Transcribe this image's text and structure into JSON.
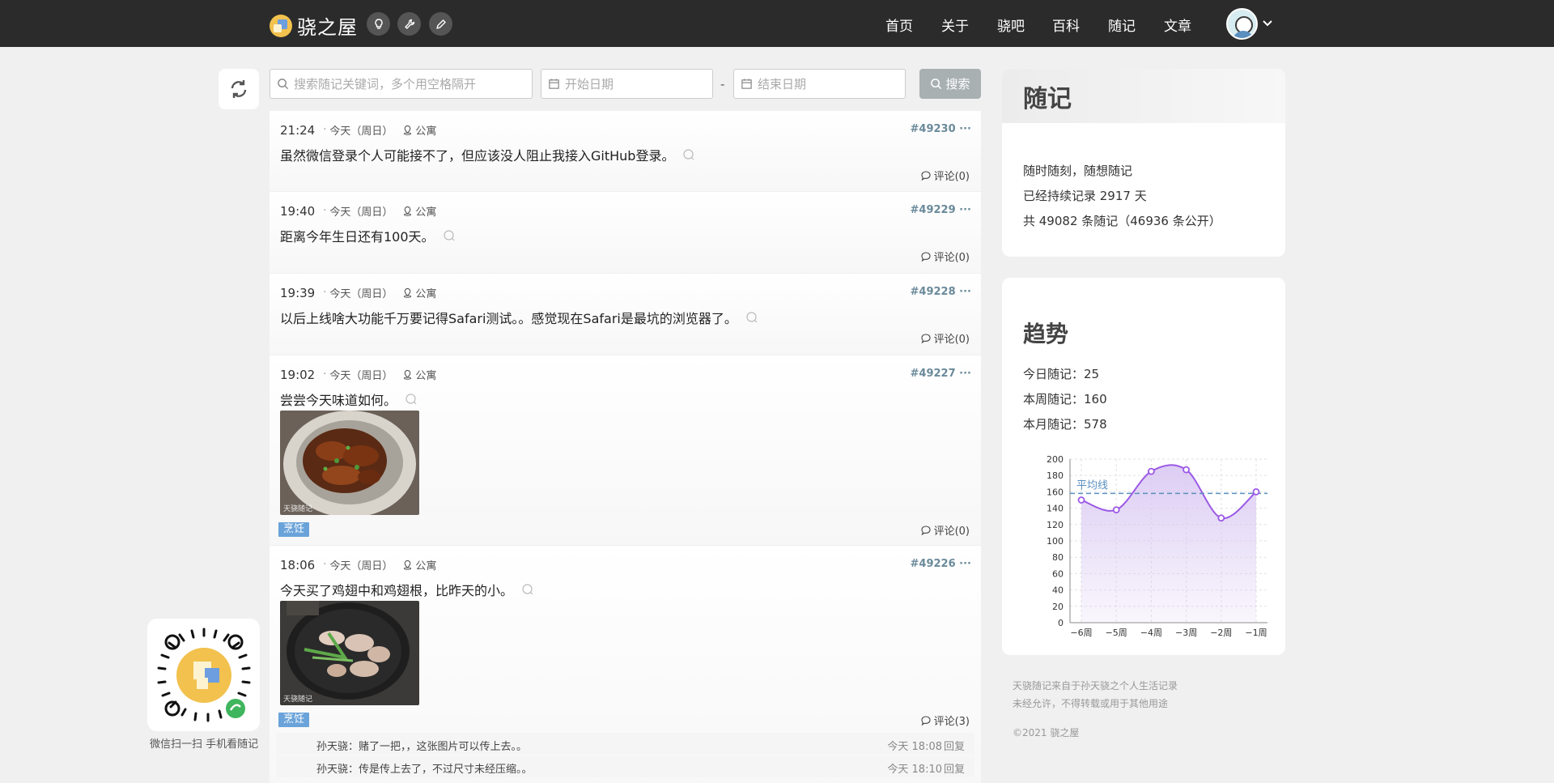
{
  "header": {
    "site_name": "骁之屋",
    "nav": [
      "首页",
      "关于",
      "骁吧",
      "百科",
      "随记",
      "文章"
    ],
    "tool_icons": [
      "lightbulb-icon",
      "wrench-icon",
      "pencil-icon"
    ]
  },
  "search": {
    "keyword_placeholder": "搜索随记关键词，多个用空格隔开",
    "start_placeholder": "开始日期",
    "end_placeholder": "结束日期",
    "separator": "-",
    "button_label": "搜索"
  },
  "entries": [
    {
      "time": "21:24",
      "day": "今天（周日）",
      "privacy": "公寓",
      "id": "#49230",
      "text": "虽然微信登录个人可能接不了，但应该没人阻止我接入GitHub登录。",
      "comments": "评论(0)"
    },
    {
      "time": "19:40",
      "day": "今天（周日）",
      "privacy": "公寓",
      "id": "#49229",
      "text": "距离今年生日还有100天。",
      "comments": "评论(0)"
    },
    {
      "time": "19:39",
      "day": "今天（周日）",
      "privacy": "公寓",
      "id": "#49228",
      "text": "以后上线啥大功能千万要记得Safari测试。。感觉现在Safari是最坑的浏览器了。",
      "comments": "评论(0)"
    },
    {
      "time": "19:02",
      "day": "今天（周日）",
      "privacy": "公寓",
      "id": "#49227",
      "text": "尝尝今天味道如何。",
      "photo_watermark": "天骁随记",
      "tag": "烹饪",
      "comments": "评论(0)"
    },
    {
      "time": "18:06",
      "day": "今天（周日）",
      "privacy": "公寓",
      "id": "#49226",
      "text": "今天买了鸡翅中和鸡翅根，比昨天的小。",
      "photo_watermark": "天骁随记",
      "tag": "烹饪",
      "comments": "评论(3)",
      "replies": [
        {
          "text": "孙天骁：赌了一把，，这张图片可以传上去。。",
          "when": "今天 18:08",
          "action": "回复"
        },
        {
          "text": "孙天骁：传是传上去了，不过尺寸未经压缩。。",
          "when": "今天 18:10",
          "action": "回复"
        }
      ]
    }
  ],
  "sidebar": {
    "about": {
      "title": "随记",
      "lines": [
        "随时随刻，随想随记",
        "已经持续记录 2917 天",
        "共 49082 条随记（46936 条公开）"
      ]
    },
    "trend": {
      "title": "趋势",
      "lines": [
        "今日随记：25",
        "本周随记：160",
        "本月随记：578"
      ]
    },
    "footer": [
      "天骁随记来自于孙天骁之个人生活记录",
      "未经允许，不得转载或用于其他用途",
      "©2021 骁之屋"
    ]
  },
  "chart_data": {
    "type": "area",
    "categories": [
      "−6周",
      "−5周",
      "−4周",
      "−3周",
      "−2周",
      "−1周"
    ],
    "values": [
      150,
      138,
      185,
      187,
      128,
      160
    ],
    "ylim": [
      0,
      200
    ],
    "yticks": [
      0,
      20,
      40,
      60,
      80,
      100,
      120,
      140,
      160,
      180,
      200
    ],
    "average_line": {
      "label": "平均线",
      "value": 158
    },
    "grid": true,
    "colors": {
      "line": "#9b59e6",
      "fill": "#d9c8f2",
      "average": "#5a8fc0"
    }
  },
  "qr": {
    "caption": "微信扫一扫 手机看随记"
  },
  "colors": {
    "topbar": "#2b2b2b",
    "tag": "#6aa3d9",
    "entry_id": "#6a8a9a"
  }
}
